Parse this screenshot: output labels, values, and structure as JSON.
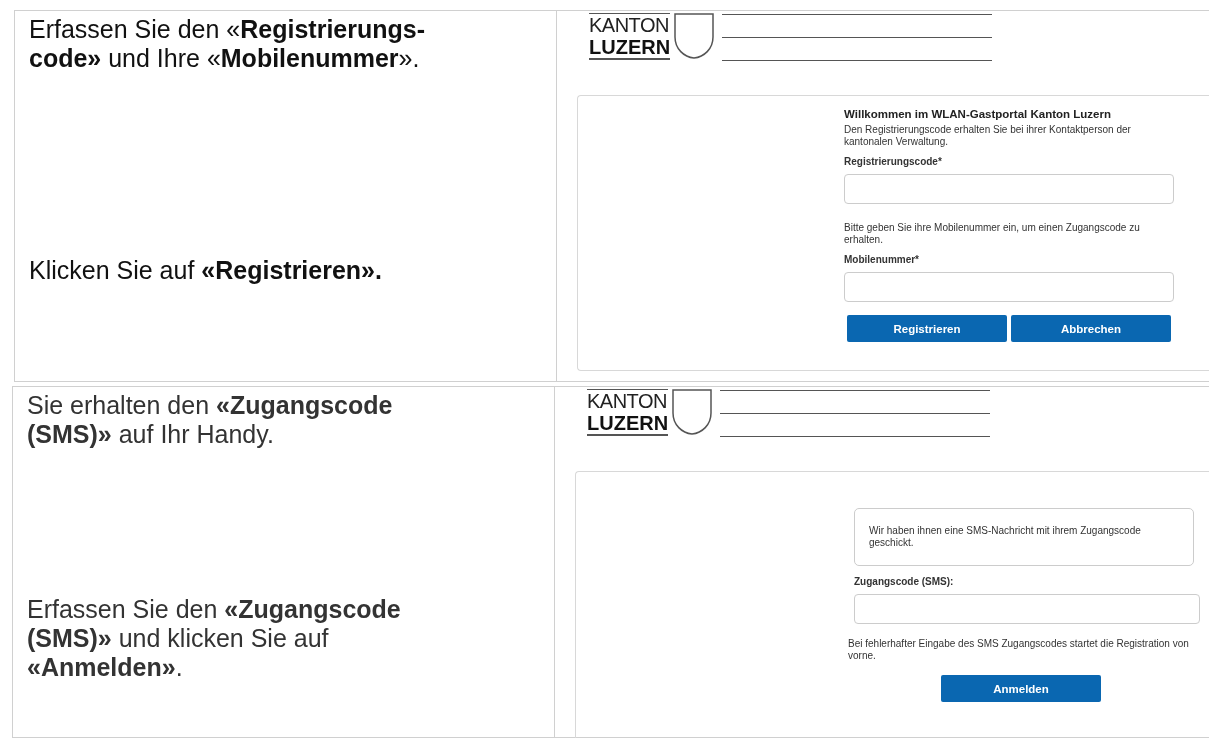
{
  "steps": [
    {
      "instructions": [
        "Erfassen Sie den «**Registrierungs-code»** und Ihre «**Mobilenummer**».",
        "Klicken Sie auf **«Registrieren».**"
      ],
      "logo": {
        "line_1": "KANTON",
        "line_2": "LUZERN"
      },
      "portal": {
        "kind": "registration",
        "title": "Willkommen im WLAN-Gastportal Kanton Luzern",
        "intro": "Den Registrierungscode erhalten Sie bei ihrer Kontaktperson der kantonalen Verwaltung.",
        "fields": [
          {
            "label": "Registrierungscode*"
          },
          {
            "label": "Mobilenummer*",
            "hint_before": "Bitte geben Sie ihre Mobilenummer ein, um einen Zugangscode zu erhalten."
          }
        ],
        "buttons": [
          "Registrieren",
          "Abbrechen"
        ]
      }
    },
    {
      "instructions": [
        "Sie erhalten den **«Zugangscode (SMS)»** auf Ihr Handy.",
        "Erfassen Sie den **«Zugangscode (SMS)»** und klicken Sie auf **«Anmelden»**."
      ],
      "logo": {
        "line_1": "KANTON",
        "line_2": "LUZERN"
      },
      "portal": {
        "kind": "sms",
        "message": "Wir haben ihnen eine SMS-Nachricht mit ihrem Zugangscode geschickt.",
        "fields": [
          {
            "label": "Zugangscode (SMS):"
          }
        ],
        "note": "Bei fehlerhafter Eingabe des SMS Zugangscodes startet die Registration von vorne.",
        "buttons": [
          "Anmelden"
        ]
      }
    }
  ]
}
